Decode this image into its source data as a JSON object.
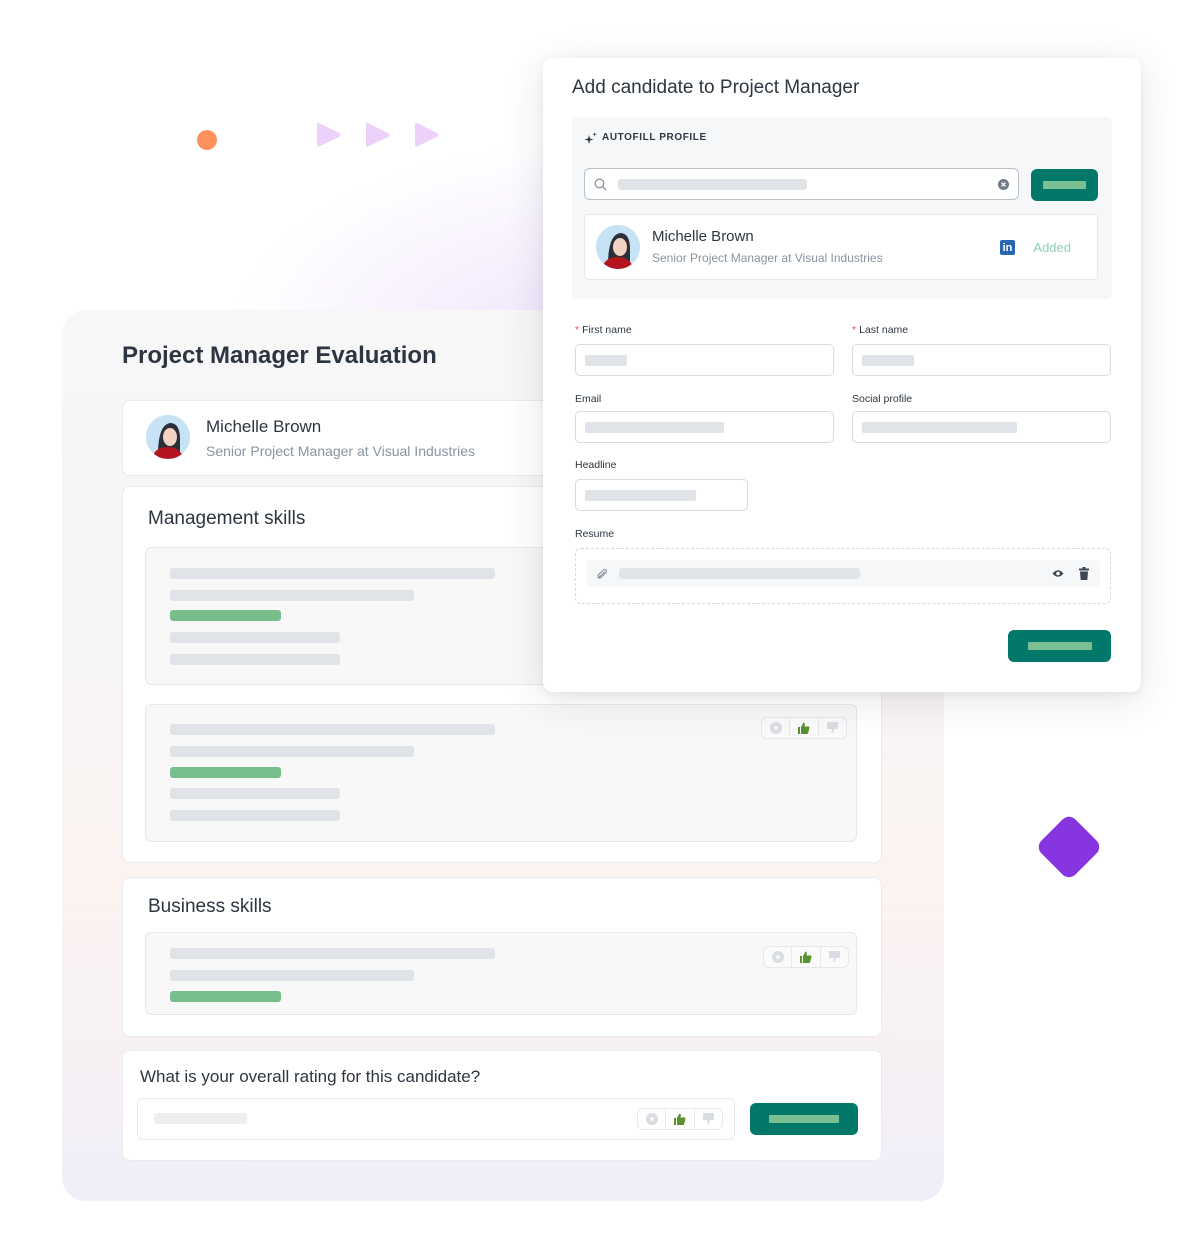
{
  "decorations": {
    "dot_color": "#ff915c",
    "triangle_color": "#ecd2fb",
    "diamond_color": "#8635e0"
  },
  "evaluation": {
    "title": "Project Manager Evaluation",
    "candidate": {
      "name": "Michelle Brown",
      "headline": "Senior Project Manager at Visual Industries",
      "avatar_icon": "avatar-illustration"
    },
    "sections": [
      {
        "title": "Management skills",
        "questions": [
          {
            "rating_selected": "thumbs-up",
            "rating_visible": false
          },
          {
            "rating_selected": "thumbs-up",
            "rating_visible": true
          }
        ]
      },
      {
        "title": "Business skills",
        "questions": [
          {
            "rating_selected": "thumbs-up",
            "rating_visible": true
          }
        ]
      }
    ],
    "overall": {
      "question": "What is your overall rating for this candidate?",
      "rating_selected": "thumbs-up",
      "rating_options": [
        "star-icon",
        "thumbs-up-icon",
        "thumbs-down-icon"
      ]
    }
  },
  "modal": {
    "title": "Add candidate to Project Manager",
    "autofill": {
      "label": "AUTOFILL PROFILE",
      "search_icon": "search-icon",
      "clear_icon": "clear-icon",
      "result": {
        "name": "Michelle Brown",
        "headline": "Senior Project Manager at Visual Industries",
        "source_icon": "linkedin-icon",
        "linkedin_glyph": "in",
        "status": "Added"
      }
    },
    "fields": {
      "first_name": {
        "label": "First name",
        "required": true,
        "required_mark": "*"
      },
      "last_name": {
        "label": "Last name",
        "required": true,
        "required_mark": "*"
      },
      "email": {
        "label": "Email",
        "required": false
      },
      "social_profile": {
        "label": "Social profile",
        "required": false
      },
      "headline": {
        "label": "Headline",
        "required": false
      },
      "resume": {
        "label": "Resume",
        "attach_icon": "paperclip-icon",
        "view_icon": "eye-icon",
        "delete_icon": "trash-icon"
      }
    }
  },
  "colors": {
    "primary_button": "#01786a",
    "placeholder_green": "#78bd8c",
    "thumbs_up_active": "#5a922f",
    "added_text": "#8fcfb4",
    "linkedin": "#2867b2",
    "required": "#e05545"
  }
}
